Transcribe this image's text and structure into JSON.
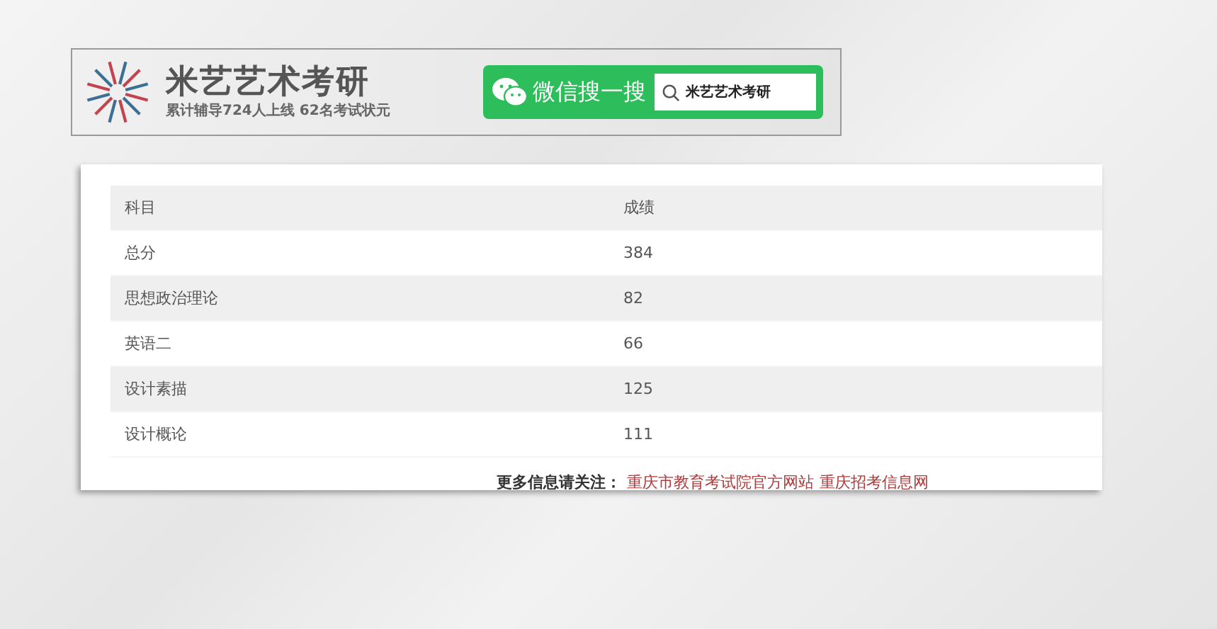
{
  "banner": {
    "title": "米艺艺术考研",
    "subtitle": "累计辅导724人上线 62名考试状元",
    "search_label": "微信搜一搜",
    "search_value": "米艺艺术考研"
  },
  "table": {
    "columns": [
      "科目",
      "成绩"
    ],
    "rows": [
      [
        "总分",
        "384"
      ],
      [
        "思想政治理论",
        "82"
      ],
      [
        "英语二",
        "66"
      ],
      [
        "设计素描",
        "125"
      ],
      [
        "设计概论",
        "111"
      ]
    ]
  },
  "footer": {
    "text": "更多信息请关注：",
    "links": [
      "重庆市教育考试院官方网站",
      "重庆招考信息网"
    ]
  }
}
